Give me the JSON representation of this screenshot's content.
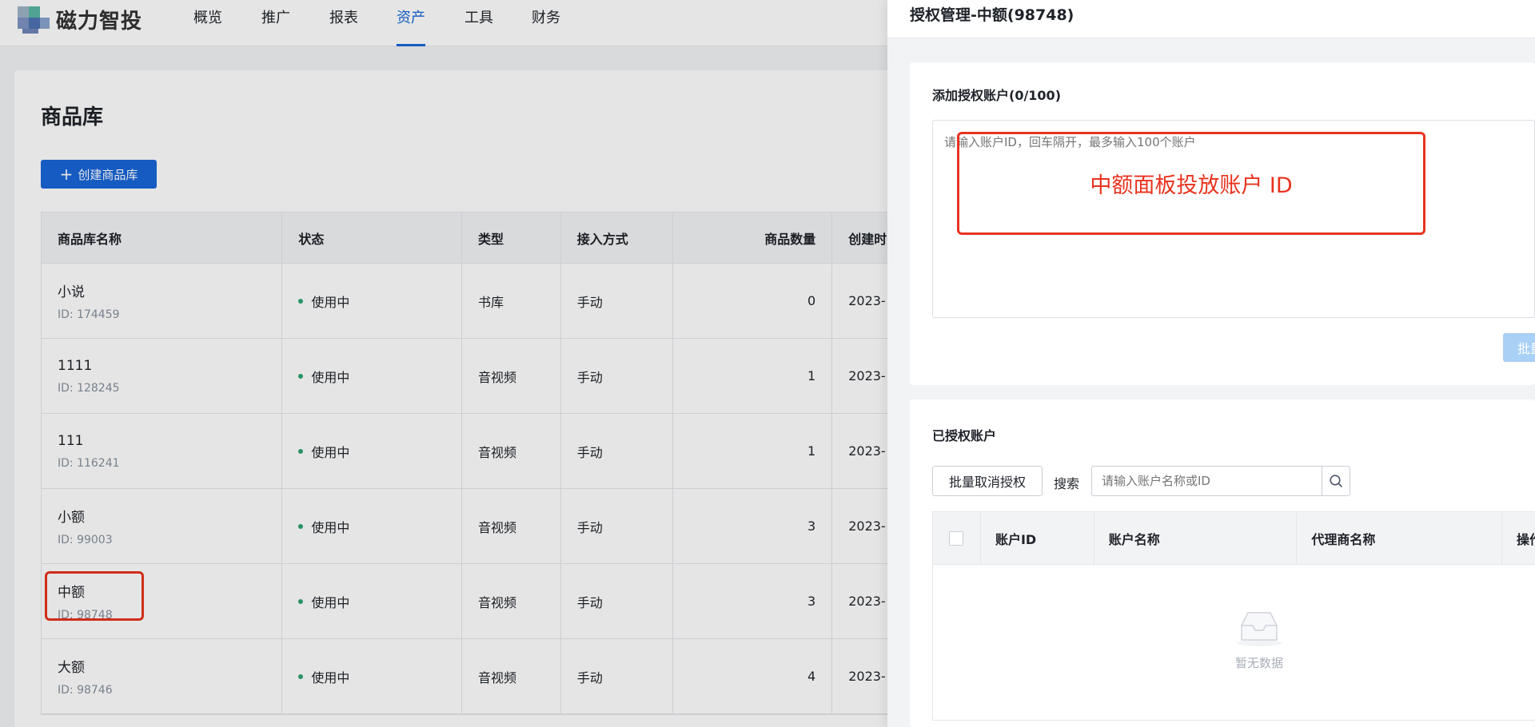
{
  "nav": {
    "brand": "磁力智投",
    "items": [
      {
        "label": "概览"
      },
      {
        "label": "推广"
      },
      {
        "label": "报表"
      },
      {
        "label": "资产",
        "active": true
      },
      {
        "label": "工具"
      },
      {
        "label": "财务"
      }
    ]
  },
  "library": {
    "title": "商品库",
    "create_label": "创建商品库",
    "columns": [
      "商品库名称",
      "状态",
      "类型",
      "接入方式",
      "商品数量",
      "创建时"
    ],
    "rows": [
      {
        "name": "小说",
        "id": "ID: 174459",
        "status": "使用中",
        "type": "书库",
        "access": "手动",
        "count": "0",
        "created": "2023-"
      },
      {
        "name": "1111",
        "id": "ID: 128245",
        "status": "使用中",
        "type": "音视频",
        "access": "手动",
        "count": "1",
        "created": "2023-"
      },
      {
        "name": "111",
        "id": "ID: 116241",
        "status": "使用中",
        "type": "音视频",
        "access": "手动",
        "count": "1",
        "created": "2023-"
      },
      {
        "name": "小额",
        "id": "ID: 99003",
        "status": "使用中",
        "type": "音视频",
        "access": "手动",
        "count": "3",
        "created": "2023-"
      },
      {
        "name": "中额",
        "id": "ID: 98748",
        "status": "使用中",
        "type": "音视频",
        "access": "手动",
        "count": "3",
        "created": "2023-"
      },
      {
        "name": "大额",
        "id": "ID: 98746",
        "status": "使用中",
        "type": "音视频",
        "access": "手动",
        "count": "4",
        "created": "2023-"
      }
    ]
  },
  "drawer": {
    "title": "授权管理-中额(98748)",
    "add": {
      "title": "添加授权账户(0/100)",
      "placeholder": "请输入账户ID，回车隔开，最多输入100个账户",
      "batch_label": "批量",
      "annotation": "中额面板投放账户 ID"
    },
    "authorized": {
      "title": "已授权账户",
      "revoke_label": "批量取消授权",
      "search_label": "搜索",
      "search_placeholder": "请输入账户名称或ID",
      "columns": [
        "账户ID",
        "账户名称",
        "代理商名称",
        "操作"
      ],
      "empty_text": "暂无数据"
    }
  },
  "colors": {
    "primary": "#1866d8",
    "annotation_red": "#e8331f",
    "status_green": "#2ba471"
  }
}
